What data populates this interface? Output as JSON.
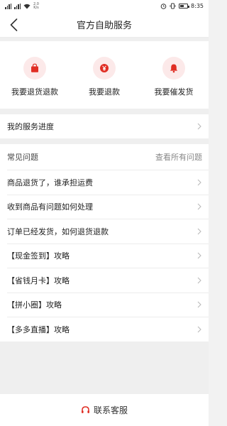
{
  "status_bar": {
    "speed_top": "2.0",
    "speed_bottom": "K/s",
    "battery_level": 0.6,
    "time": "8:35"
  },
  "nav": {
    "title": "官方自助服务",
    "back_icon": "chevron-left-icon"
  },
  "actions": [
    {
      "label": "我要退货退款",
      "icon": "shopping-bag-icon"
    },
    {
      "label": "我要退款",
      "icon": "yen-coin-icon"
    },
    {
      "label": "我要催发货",
      "icon": "bell-icon"
    }
  ],
  "progress": {
    "label": "我的服务进度"
  },
  "faq": {
    "title": "常见问题",
    "view_all": "查看所有问题",
    "items": [
      "商品退货了，谁承担运费",
      "收到商品有问题如何处理",
      "订单已经发货，如何退货退款",
      "【现金签到】攻略",
      "【省钱月卡】攻略",
      "【拼小圈】攻略",
      "【多多直播】攻略"
    ]
  },
  "contact": {
    "label": "联系客服",
    "icon": "headset-icon"
  },
  "colors": {
    "accent": "#e02e24",
    "icon_bg": "#fce9e9",
    "page_bg": "#efefef"
  }
}
